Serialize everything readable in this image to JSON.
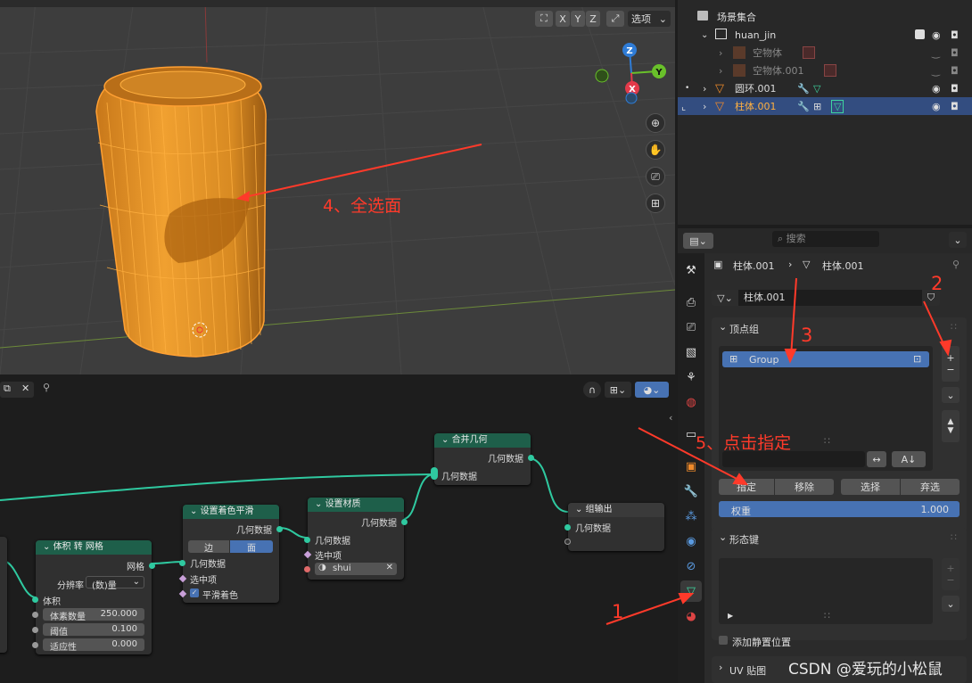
{
  "viewport": {
    "select_label": "选项",
    "axes": {
      "x": "X",
      "y": "Y",
      "z": "Z"
    },
    "annotation_4": "4、全选面",
    "tools": [
      "zoom-icon",
      "hand-icon",
      "camera-icon",
      "grid-icon"
    ]
  },
  "outliner": {
    "rows": [
      {
        "label": "场景集合"
      },
      {
        "label": "huan_jin"
      },
      {
        "label": "空物体"
      },
      {
        "label": "空物体.001"
      },
      {
        "label": "圆环.001"
      },
      {
        "label": "柱体.001"
      }
    ]
  },
  "properties": {
    "search_placeholder": "搜索",
    "breadcrumb_object": "柱体.001",
    "breadcrumb_mesh": "柱体.001",
    "mesh_name": "柱体.001",
    "vertex_groups_title": "顶点组",
    "group_item": "Group",
    "assign": "指定",
    "remove": "移除",
    "select": "选择",
    "deselect": "弃选",
    "weight_label": "权重",
    "weight_value": "1.000",
    "shape_keys_title": "形态键",
    "add_rest_position": "添加静置位置",
    "uv_maps_title": "UV 贴图",
    "sort_label": "A↓"
  },
  "annotations": {
    "n1": "1",
    "n2": "2",
    "n3": "3",
    "n5": "5、点击指定"
  },
  "nodes": {
    "join": {
      "title": "合并几何",
      "out": "几何数据",
      "in": "几何数据"
    },
    "group_out": {
      "title": "组输出",
      "in": "几何数据"
    },
    "material": {
      "title": "设置材质",
      "out": "几何数据",
      "in_geo": "几何数据",
      "in_sel": "选中项",
      "material": "shui"
    },
    "smooth": {
      "title": "设置着色平滑",
      "out": "几何数据",
      "tab_edge": "边",
      "tab_face": "面",
      "in_geo": "几何数据",
      "in_sel": "选中项",
      "in_smooth": "平滑着色"
    },
    "vol2mesh": {
      "title": "体积 转 网格",
      "out": "网格",
      "resolution_label": "分辨率",
      "resolution_value": "(数)量",
      "volume": "体积",
      "voxel_label": "体素数量",
      "voxel_value": "250.000",
      "threshold_label": "阈值",
      "threshold_value": "0.100",
      "adapt_label": "适应性",
      "adapt_value": "0.000"
    }
  },
  "watermark": "CSDN @爱玩的小松鼠",
  "colors": {
    "accent": "#4772b3",
    "node_header": "#1e5f4a",
    "annotation": "#ff3a2a",
    "selection_orange": "#ffa033"
  }
}
